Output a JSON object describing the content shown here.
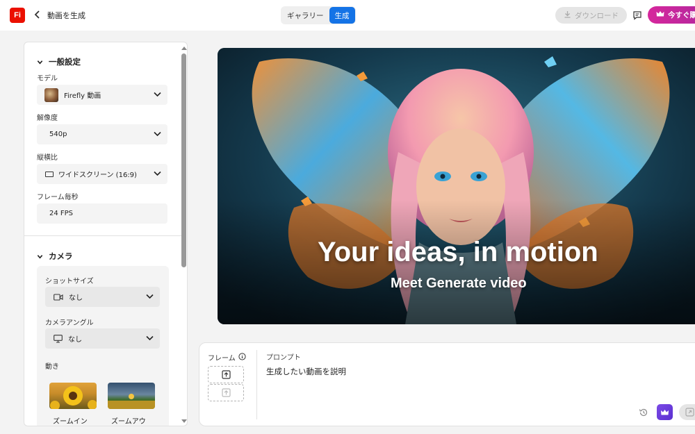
{
  "header": {
    "logo_text": "Fi",
    "title": "動画を生成",
    "tabs": [
      {
        "label": "ギャラリー",
        "active": false
      },
      {
        "label": "生成",
        "active": true
      }
    ],
    "download_label": "ダウンロード",
    "buy_label": "今すぐ購入"
  },
  "sidebar": {
    "general": {
      "title": "一般設定",
      "model_label": "モデル",
      "model_value": "Firefly 動画",
      "resolution_label": "解像度",
      "resolution_value": "540p",
      "aspect_label": "縦横比",
      "aspect_value": "ワイドスクリーン (16:9)",
      "fps_label": "フレーム毎秒",
      "fps_value": "24 FPS"
    },
    "camera": {
      "title": "カメラ",
      "shot_label": "ショットサイズ",
      "shot_value": "なし",
      "angle_label": "カメラアングル",
      "angle_value": "なし",
      "motion_label": "動き",
      "motion_options": [
        "ズームイン",
        "ズームアウ"
      ]
    }
  },
  "hero": {
    "title": "Your ideas, in motion",
    "subtitle": "Meet Generate video"
  },
  "prompt": {
    "frame_label": "フレーム",
    "prompt_label": "プロンプト",
    "placeholder": "生成したい動画を説明"
  },
  "colors": {
    "accent_blue": "#1473e6",
    "logo_red": "#eb1000",
    "buy_pink": "#d6279c",
    "premium_purple": "#6a3be0"
  },
  "icons": [
    "back-icon",
    "download-icon",
    "feedback-icon",
    "crown-icon",
    "chevron-down-icon",
    "info-icon",
    "upload-icon",
    "history-icon",
    "video-camera-icon",
    "monitor-icon",
    "aspect-ratio-icon"
  ]
}
